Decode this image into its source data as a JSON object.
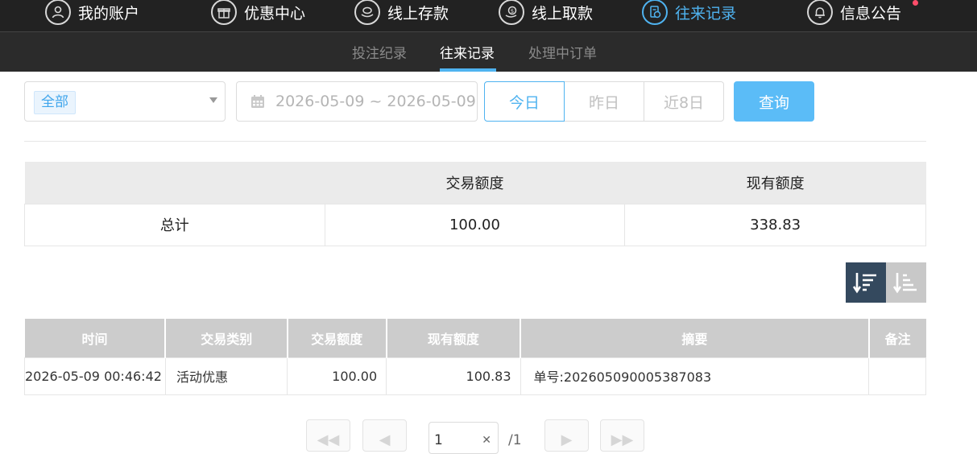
{
  "nav": {
    "items": [
      {
        "label": "我的账户",
        "icon": "user-icon"
      },
      {
        "label": "优惠中心",
        "icon": "gift-icon"
      },
      {
        "label": "线上存款",
        "icon": "deposit-icon"
      },
      {
        "label": "线上取款",
        "icon": "withdraw-icon"
      },
      {
        "label": "往来记录",
        "icon": "records-icon",
        "active": true
      },
      {
        "label": "信息公告",
        "icon": "bell-icon"
      }
    ],
    "accent_color": "#4fb3f0",
    "notification_dot_color": "#ff4d6a"
  },
  "subnav": {
    "items": [
      {
        "label": "投注纪录"
      },
      {
        "label": "往来记录",
        "active": true
      },
      {
        "label": "处理中订单"
      }
    ]
  },
  "filters": {
    "type_select": {
      "selected": "全部"
    },
    "date_range": {
      "value": "2026-05-09 ~ 2026-05-09"
    },
    "quick_ranges": [
      "今日",
      "昨日",
      "近8日"
    ],
    "active_range": "今日",
    "query_label": "查询"
  },
  "summary": {
    "headers": [
      "",
      "交易额度",
      "现有额度"
    ],
    "row": {
      "label": "总计",
      "amount": "100.00",
      "balance": "338.83"
    }
  },
  "records": {
    "headers": [
      "时间",
      "交易类别",
      "交易额度",
      "现有额度",
      "摘要",
      "备注"
    ],
    "rows": [
      {
        "time": "2026-05-09 00:46:42",
        "type": "活动优惠",
        "amount": "100.00",
        "balance": "100.83",
        "summary": "单号:202605090005387083",
        "note": ""
      }
    ]
  },
  "pagination": {
    "current_page": "1",
    "total_pages": "/1"
  }
}
